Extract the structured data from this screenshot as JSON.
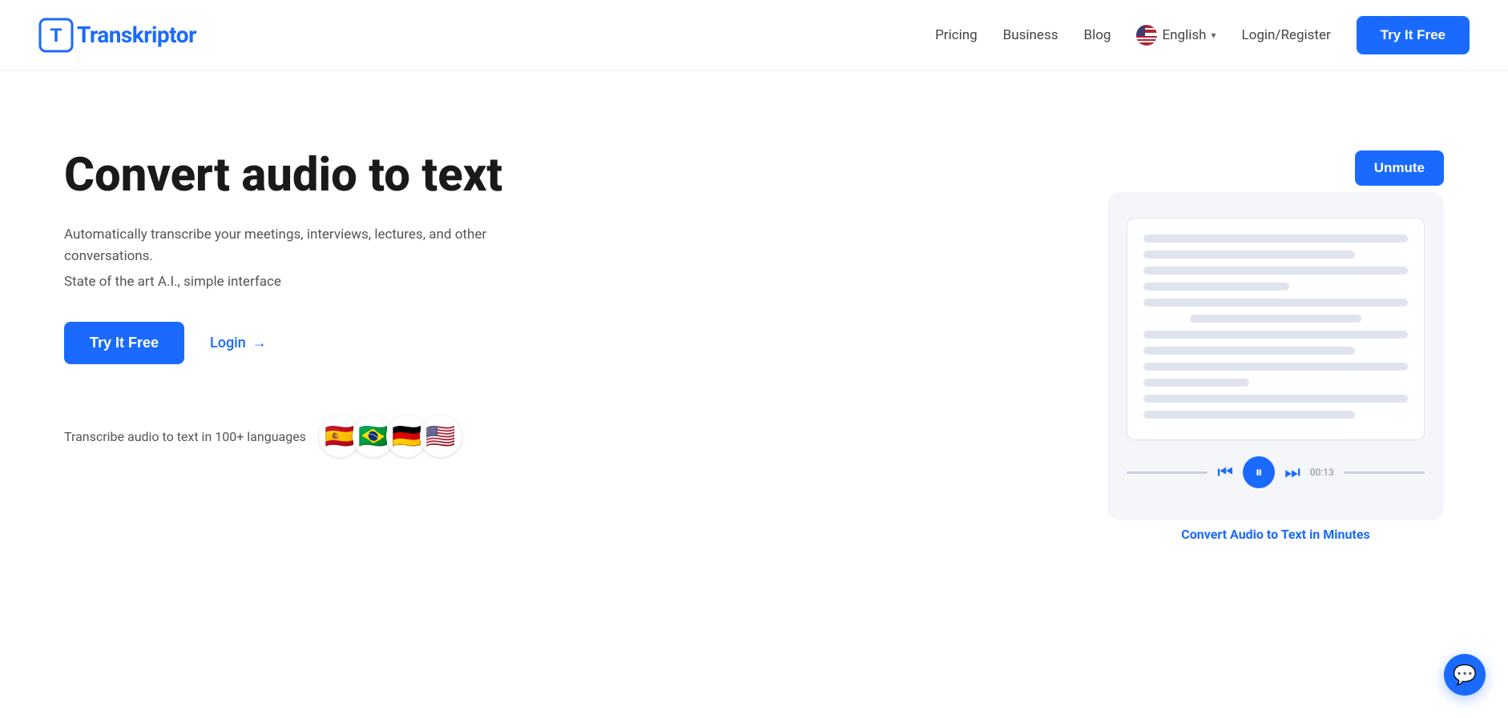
{
  "nav": {
    "logo_t": "T",
    "logo_rest": "ranskriptor",
    "links": [
      {
        "label": "Pricing",
        "id": "pricing"
      },
      {
        "label": "Business",
        "id": "business"
      },
      {
        "label": "Blog",
        "id": "blog"
      }
    ],
    "language": "English",
    "login_label": "Login/Register",
    "cta_label": "Try It Free"
  },
  "hero": {
    "title": "Convert audio to text",
    "subtitle": "Automatically transcribe your meetings, interviews, lectures, and other conversations.",
    "subtext": "State of the art A.I., simple interface",
    "cta_label": "Try It Free",
    "login_label": "Login",
    "login_arrow": "→",
    "lang_label": "Transcribe audio to text in 100+ languages",
    "flags": [
      "🇪🇸",
      "🇧🇷",
      "🇩🇪",
      "🇺🇸"
    ],
    "unmute_label": "Unmute",
    "card_caption": "Convert Audio to Text in Minutes",
    "player_time": "00:13"
  }
}
